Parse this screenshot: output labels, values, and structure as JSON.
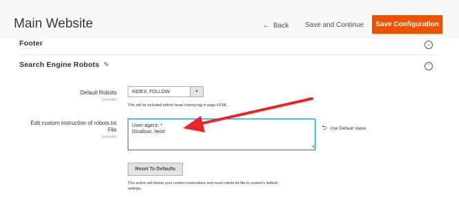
{
  "header": {
    "title": "Main Website",
    "back_icon": "←",
    "back_label": "Back",
    "save_continue_label": "Save and Continue",
    "save_config_label": "Save Configuration",
    "accent_color": "#eb5202"
  },
  "sections": {
    "footer_label": "Footer",
    "footer_toggle": "⌄",
    "robots_label": "Search Engine Robots",
    "robots_toggle": "⌃",
    "pencil": "✎"
  },
  "robots": {
    "default_robots_label": "Default Robots",
    "default_robots_scope": "[website]",
    "default_robots_value": "INDEX, FOLLOW",
    "default_robots_arrow": "▼",
    "default_robots_note": "This will be included before head closing tag in page HTML.",
    "custom_label_line1": "Edit custom instruction of robots.txt",
    "custom_label_line2": "File",
    "custom_scope": "[website]",
    "custom_value_line1": "User-agent: *",
    "custom_value_line2": "Disallow: /test/",
    "use_default_icon": "⮌",
    "use_default_label": "Use Default Value",
    "reset_label": "Reset To Defaults",
    "reset_note_line1": "This action will delete your custom instructions and reset robots.txt file to system's default",
    "reset_note_line2": "settings."
  },
  "annotation": {
    "arrow_color": "#e8252a"
  }
}
